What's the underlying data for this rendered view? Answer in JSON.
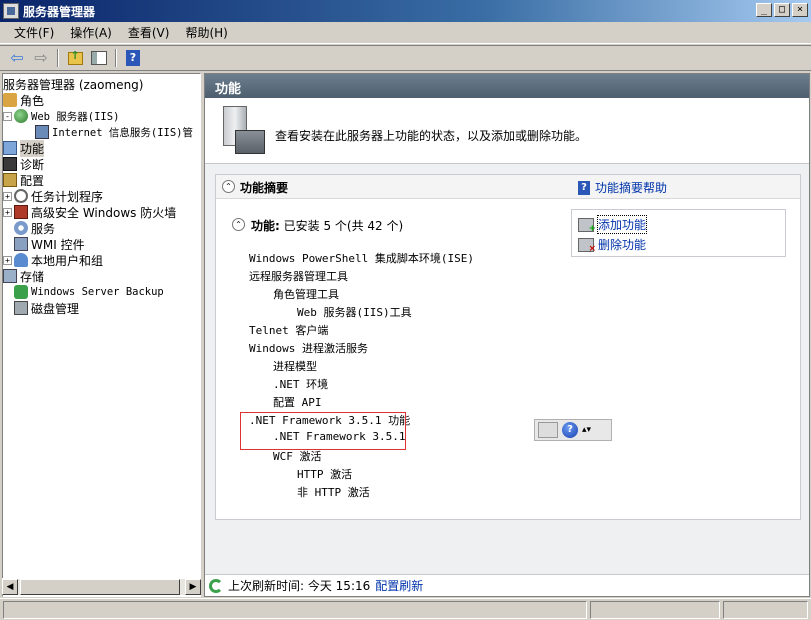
{
  "window": {
    "title": "服务器管理器",
    "buttons": {
      "minimize": "_",
      "maximize": "□",
      "close": "×"
    }
  },
  "menu": {
    "items": [
      "文件(F)",
      "操作(A)",
      "查看(V)",
      "帮助(H)"
    ]
  },
  "toolbar": {
    "icons": [
      "back-icon",
      "forward-icon",
      "up-icon",
      "show-hide-tree-icon",
      "help-icon"
    ],
    "back_glyph": "⇦",
    "forward_glyph": "⇨",
    "help_glyph": "?"
  },
  "tree": {
    "root": "服务器管理器 (zaomeng)",
    "roles": "角色",
    "web_server": "Web 服务器(IIS)",
    "iis_manager": "Internet 信息服务(IIS)管",
    "features": "功能",
    "diagnostics": "诊断",
    "configuration": "配置",
    "task_scheduler": "任务计划程序",
    "firewall": "高级安全 Windows 防火墙",
    "services": "服务",
    "wmi": "WMI 控件",
    "local_users": "本地用户和组",
    "storage": "存储",
    "backup": "Windows Server Backup",
    "disk_management": "磁盘管理",
    "expander_plus": "+",
    "expander_minus": "-"
  },
  "scrollbar": {
    "left_glyph": "◀",
    "right_glyph": "▶"
  },
  "main": {
    "header": "功能",
    "intro": "查看安装在此服务器上功能的状态，以及添加或删除功能。",
    "section_title": "功能摘要",
    "help_link": "功能摘要帮助",
    "help_glyph": "?",
    "collapse_glyph": "⌃",
    "sub_title_label": "功能:",
    "sub_title_value": "已安装 5 个(共 42 个)",
    "actions": {
      "add": "添加功能",
      "remove": "删除功能"
    },
    "features": [
      "Windows PowerShell 集成脚本环境(ISE)",
      "远程服务器管理工具",
      "角色管理工具",
      "Web 服务器(IIS)工具",
      "Telnet 客户端",
      "Windows 进程激活服务",
      "进程模型",
      ".NET 环境",
      "配置 API",
      ".NET Framework 3.5.1 功能",
      ".NET Framework 3.5.1",
      "WCF 激活",
      "HTTP 激活",
      "非 HTTP 激活"
    ],
    "float_help_glyph": "?",
    "float_more_glyph": "▴▾"
  },
  "status": {
    "refresh_label": "上次刷新时间: 今天 15:16",
    "refresh_link": "配置刷新"
  }
}
